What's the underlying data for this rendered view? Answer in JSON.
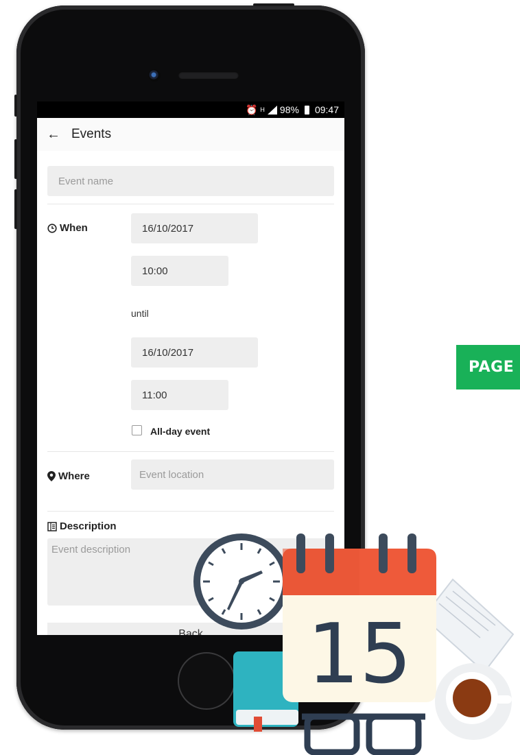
{
  "status_bar": {
    "alarm_icon": "alarm-clock-icon",
    "signal_label": "H",
    "battery": "98%",
    "time": "09:47"
  },
  "app_bar": {
    "back_icon": "arrow-left-icon",
    "title": "Events"
  },
  "form": {
    "event_name_placeholder": "Event name",
    "when_label": "When",
    "start_date": "16/10/2017",
    "start_time": "10:00",
    "until_label": "until",
    "end_date": "16/10/2017",
    "end_time": "11:00",
    "all_day_label": "All-day event",
    "all_day_checked": false,
    "where_label": "Where",
    "location_placeholder": "Event location",
    "description_label": "Description",
    "description_placeholder": "Event description",
    "back_button": "Back"
  },
  "badge": {
    "text": "PAGE"
  },
  "illustration": {
    "calendar_day": "15",
    "calendar_color": "#ee5a3a",
    "clock_hands": "time"
  }
}
